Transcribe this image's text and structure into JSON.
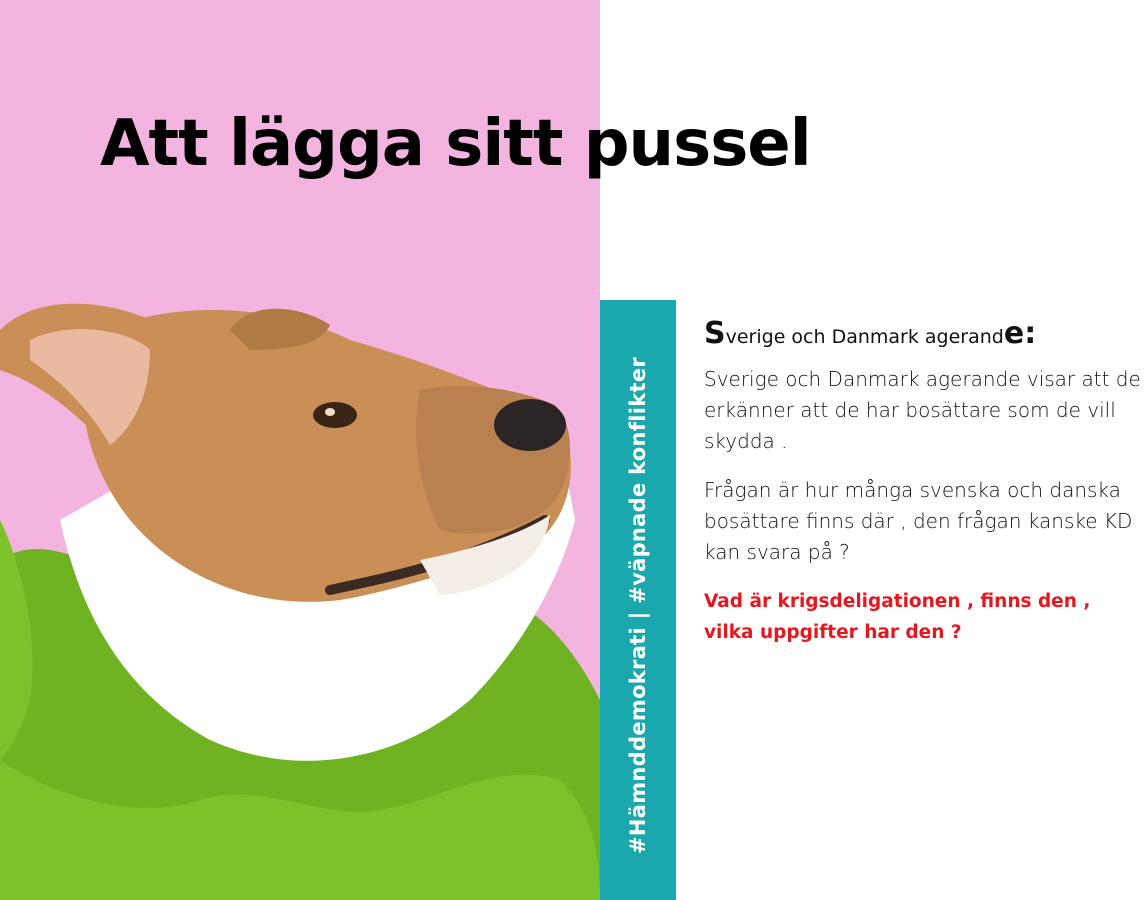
{
  "title": "Att lägga sitt pussel",
  "hashtags": "#Hämnddemokrati  |  #väpnade konflikter",
  "heading": {
    "first_letter": "S",
    "middle": "verige och Danmark agerand",
    "last_letter": "e:"
  },
  "paragraphs": [
    "Sverige och Danmark agerande visar att de erkänner att de har bosättare som de vill skydda  .",
    "Frågan är hur många svenska och danska bosättare finns där , den frågan kanske KD kan svara på  ?"
  ],
  "question": "Vad är krigsdeligationen , finns den , vilka uppgifter har den ?",
  "colors": {
    "background_pink": "#f3b5df",
    "tag_bar": "#1aa8ae",
    "question_red": "#e8161e"
  }
}
